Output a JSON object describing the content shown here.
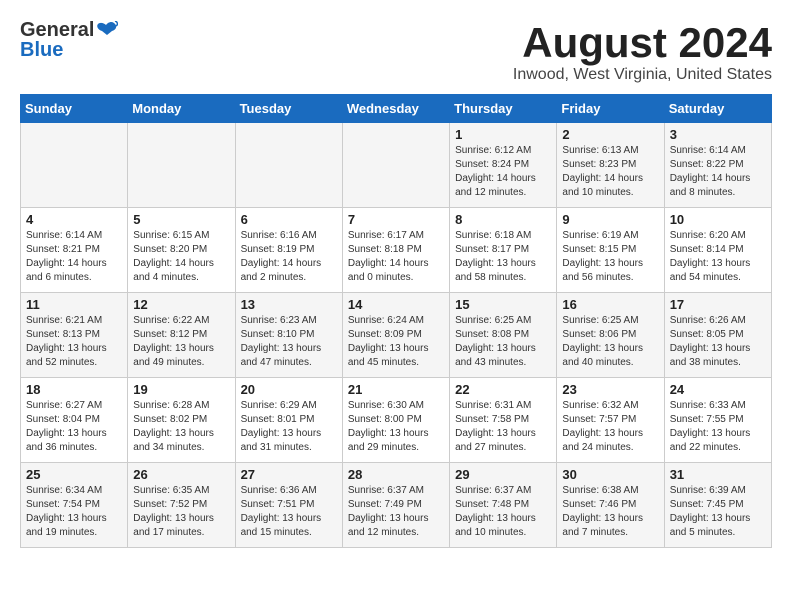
{
  "header": {
    "logo_general": "General",
    "logo_blue": "Blue",
    "month": "August 2024",
    "location": "Inwood, West Virginia, United States"
  },
  "weekdays": [
    "Sunday",
    "Monday",
    "Tuesday",
    "Wednesday",
    "Thursday",
    "Friday",
    "Saturday"
  ],
  "weeks": [
    [
      {
        "day": "",
        "info": ""
      },
      {
        "day": "",
        "info": ""
      },
      {
        "day": "",
        "info": ""
      },
      {
        "day": "",
        "info": ""
      },
      {
        "day": "1",
        "info": "Sunrise: 6:12 AM\nSunset: 8:24 PM\nDaylight: 14 hours\nand 12 minutes."
      },
      {
        "day": "2",
        "info": "Sunrise: 6:13 AM\nSunset: 8:23 PM\nDaylight: 14 hours\nand 10 minutes."
      },
      {
        "day": "3",
        "info": "Sunrise: 6:14 AM\nSunset: 8:22 PM\nDaylight: 14 hours\nand 8 minutes."
      }
    ],
    [
      {
        "day": "4",
        "info": "Sunrise: 6:14 AM\nSunset: 8:21 PM\nDaylight: 14 hours\nand 6 minutes."
      },
      {
        "day": "5",
        "info": "Sunrise: 6:15 AM\nSunset: 8:20 PM\nDaylight: 14 hours\nand 4 minutes."
      },
      {
        "day": "6",
        "info": "Sunrise: 6:16 AM\nSunset: 8:19 PM\nDaylight: 14 hours\nand 2 minutes."
      },
      {
        "day": "7",
        "info": "Sunrise: 6:17 AM\nSunset: 8:18 PM\nDaylight: 14 hours\nand 0 minutes."
      },
      {
        "day": "8",
        "info": "Sunrise: 6:18 AM\nSunset: 8:17 PM\nDaylight: 13 hours\nand 58 minutes."
      },
      {
        "day": "9",
        "info": "Sunrise: 6:19 AM\nSunset: 8:15 PM\nDaylight: 13 hours\nand 56 minutes."
      },
      {
        "day": "10",
        "info": "Sunrise: 6:20 AM\nSunset: 8:14 PM\nDaylight: 13 hours\nand 54 minutes."
      }
    ],
    [
      {
        "day": "11",
        "info": "Sunrise: 6:21 AM\nSunset: 8:13 PM\nDaylight: 13 hours\nand 52 minutes."
      },
      {
        "day": "12",
        "info": "Sunrise: 6:22 AM\nSunset: 8:12 PM\nDaylight: 13 hours\nand 49 minutes."
      },
      {
        "day": "13",
        "info": "Sunrise: 6:23 AM\nSunset: 8:10 PM\nDaylight: 13 hours\nand 47 minutes."
      },
      {
        "day": "14",
        "info": "Sunrise: 6:24 AM\nSunset: 8:09 PM\nDaylight: 13 hours\nand 45 minutes."
      },
      {
        "day": "15",
        "info": "Sunrise: 6:25 AM\nSunset: 8:08 PM\nDaylight: 13 hours\nand 43 minutes."
      },
      {
        "day": "16",
        "info": "Sunrise: 6:25 AM\nSunset: 8:06 PM\nDaylight: 13 hours\nand 40 minutes."
      },
      {
        "day": "17",
        "info": "Sunrise: 6:26 AM\nSunset: 8:05 PM\nDaylight: 13 hours\nand 38 minutes."
      }
    ],
    [
      {
        "day": "18",
        "info": "Sunrise: 6:27 AM\nSunset: 8:04 PM\nDaylight: 13 hours\nand 36 minutes."
      },
      {
        "day": "19",
        "info": "Sunrise: 6:28 AM\nSunset: 8:02 PM\nDaylight: 13 hours\nand 34 minutes."
      },
      {
        "day": "20",
        "info": "Sunrise: 6:29 AM\nSunset: 8:01 PM\nDaylight: 13 hours\nand 31 minutes."
      },
      {
        "day": "21",
        "info": "Sunrise: 6:30 AM\nSunset: 8:00 PM\nDaylight: 13 hours\nand 29 minutes."
      },
      {
        "day": "22",
        "info": "Sunrise: 6:31 AM\nSunset: 7:58 PM\nDaylight: 13 hours\nand 27 minutes."
      },
      {
        "day": "23",
        "info": "Sunrise: 6:32 AM\nSunset: 7:57 PM\nDaylight: 13 hours\nand 24 minutes."
      },
      {
        "day": "24",
        "info": "Sunrise: 6:33 AM\nSunset: 7:55 PM\nDaylight: 13 hours\nand 22 minutes."
      }
    ],
    [
      {
        "day": "25",
        "info": "Sunrise: 6:34 AM\nSunset: 7:54 PM\nDaylight: 13 hours\nand 19 minutes."
      },
      {
        "day": "26",
        "info": "Sunrise: 6:35 AM\nSunset: 7:52 PM\nDaylight: 13 hours\nand 17 minutes."
      },
      {
        "day": "27",
        "info": "Sunrise: 6:36 AM\nSunset: 7:51 PM\nDaylight: 13 hours\nand 15 minutes."
      },
      {
        "day": "28",
        "info": "Sunrise: 6:37 AM\nSunset: 7:49 PM\nDaylight: 13 hours\nand 12 minutes."
      },
      {
        "day": "29",
        "info": "Sunrise: 6:37 AM\nSunset: 7:48 PM\nDaylight: 13 hours\nand 10 minutes."
      },
      {
        "day": "30",
        "info": "Sunrise: 6:38 AM\nSunset: 7:46 PM\nDaylight: 13 hours\nand 7 minutes."
      },
      {
        "day": "31",
        "info": "Sunrise: 6:39 AM\nSunset: 7:45 PM\nDaylight: 13 hours\nand 5 minutes."
      }
    ]
  ]
}
